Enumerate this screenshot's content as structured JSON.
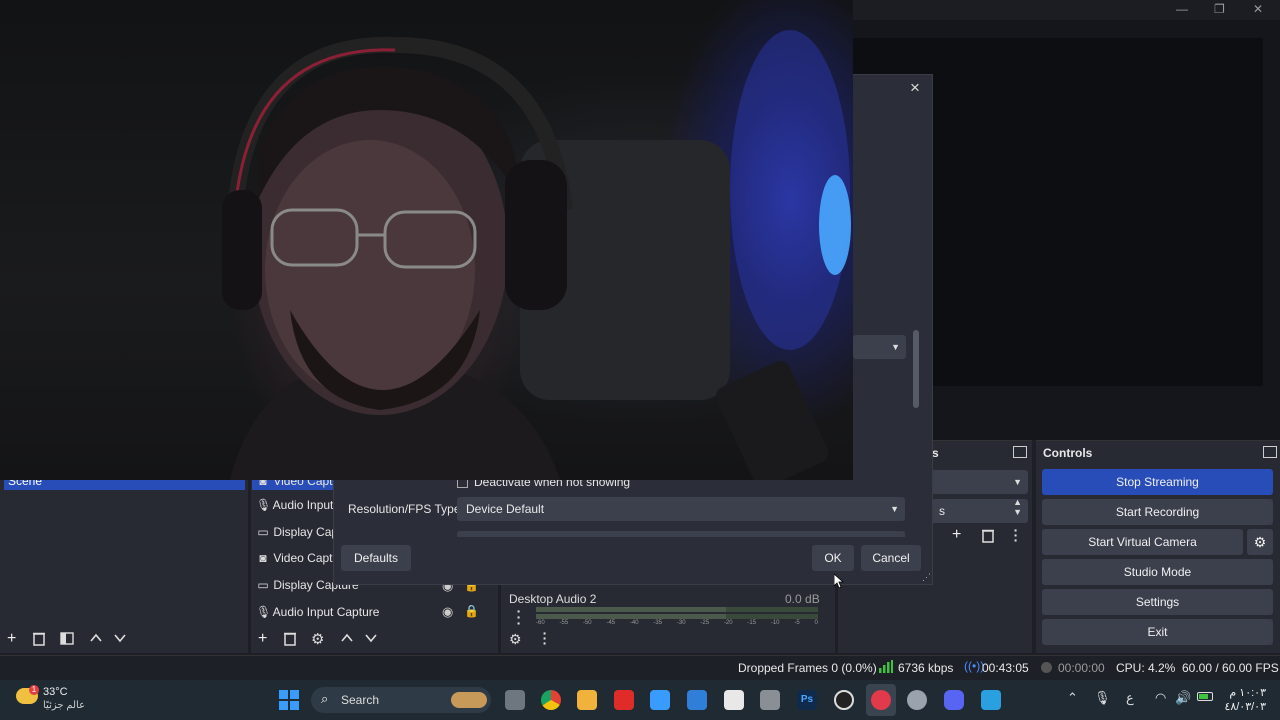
{
  "dialog": {
    "close_label": "×",
    "deactivate_label": "Deactivate when not showing",
    "resolution_label": "Resolution/FPS Type",
    "resolution_value": "Device Default",
    "defaults_label": "Defaults",
    "ok_label": "OK",
    "cancel_label": "Cancel"
  },
  "scenes": {
    "items": [
      "Scene"
    ]
  },
  "sources": {
    "items": [
      {
        "label": "Video Captu",
        "icon": "camera-icon"
      },
      {
        "label": "Audio Input",
        "icon": "mic-icon"
      },
      {
        "label": "Display Cap",
        "icon": "monitor-icon"
      },
      {
        "label": "Video Captu",
        "icon": "camera-icon"
      },
      {
        "label": "Display Capture",
        "icon": "monitor-icon"
      },
      {
        "label": "Audio Input Capture",
        "icon": "mic-icon"
      }
    ]
  },
  "mixer": {
    "channel_name": "Desktop Audio 2",
    "channel_db": "0.0 dB",
    "scale": [
      "-60",
      "-55",
      "-50",
      "-45",
      "-40",
      "-35",
      "-30",
      "-25",
      "-20",
      "-15",
      "-10",
      "-5",
      "0"
    ]
  },
  "transitions": {
    "title_fragment": "s",
    "duration_fragment": "s"
  },
  "controls": {
    "title": "Controls",
    "stop_streaming": "Stop Streaming",
    "start_recording": "Start Recording",
    "start_virtual_camera": "Start Virtual Camera",
    "studio_mode": "Studio Mode",
    "settings": "Settings",
    "exit": "Exit"
  },
  "statusbar": {
    "dropped_frames": "Dropped Frames 0 (0.0%)",
    "bitrate": "6736 kbps",
    "stream_time": "00:43:05",
    "rec_time": "00:00:00",
    "cpu": "CPU: 4.2%",
    "fps": "60.00 / 60.00 FPS"
  },
  "taskbar": {
    "weather_temp": "33°C",
    "weather_desc": "عالم جزئيًا",
    "weather_badge": "1",
    "search_label": "Search",
    "lang": "ع",
    "time": "١٠:٠٣ م",
    "date": "٤٨/٠٣/٠٣"
  },
  "colors": {
    "accent": "#284cb8",
    "panel": "#272a33",
    "dialog": "#2b2e38",
    "button": "#3c404d",
    "signal_green": "#3ec43e",
    "stream_blue": "#4a8cff"
  }
}
